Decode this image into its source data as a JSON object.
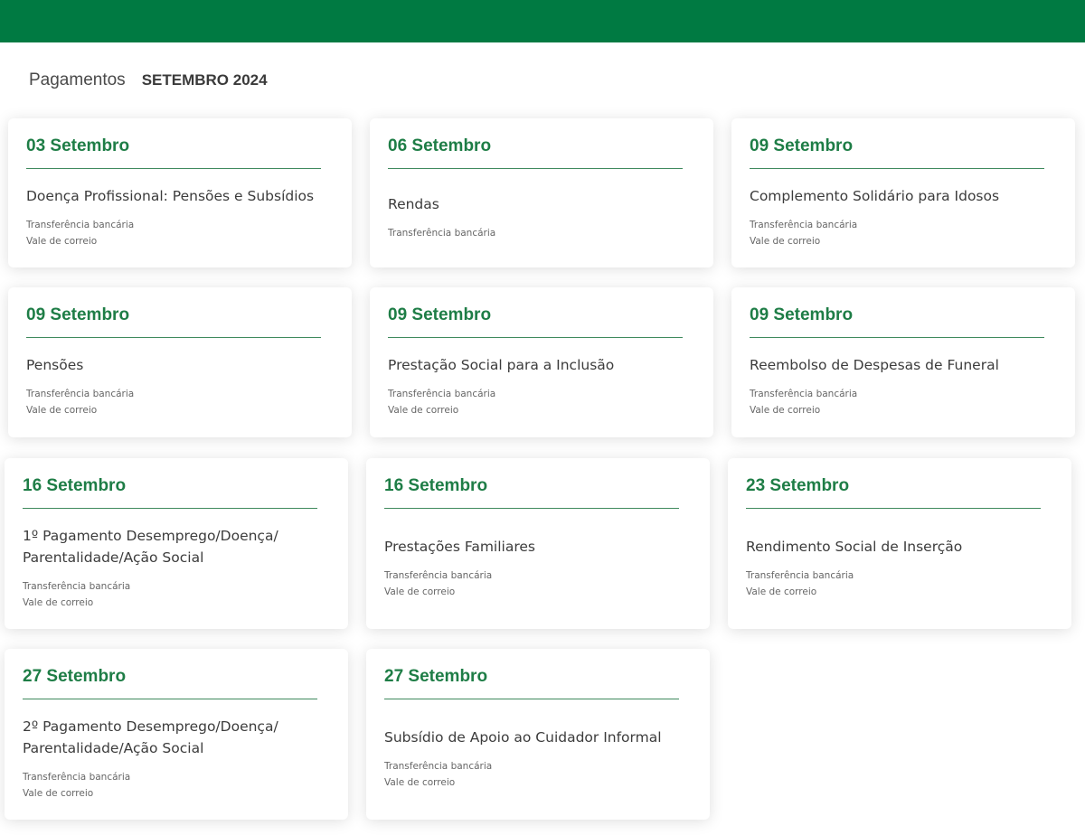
{
  "header": {
    "title": "Pagamentos",
    "month": "SETEMBRO 2024"
  },
  "accent_color": "#007a42",
  "cards": [
    {
      "date": "03 Setembro",
      "name": "Doença Profissional: Pensões e Subsídios",
      "methods": [
        "Transferência bancária",
        "Vale de correio"
      ]
    },
    {
      "date": "06 Setembro",
      "name": "Rendas",
      "methods": [
        "Transferência bancária"
      ]
    },
    {
      "date": "09 Setembro",
      "name": "Complemento Solidário para Idosos",
      "methods": [
        "Transferência bancária",
        "Vale de correio"
      ]
    },
    {
      "date": "09 Setembro",
      "name": "Pensões",
      "methods": [
        "Transferência bancária",
        "Vale de correio"
      ]
    },
    {
      "date": "09 Setembro",
      "name": "Prestação Social para a Inclusão",
      "methods": [
        "Transferência bancária",
        "Vale de correio"
      ]
    },
    {
      "date": "09 Setembro",
      "name": "Reembolso de Despesas de Funeral",
      "methods": [
        "Transferência bancária",
        "Vale de correio"
      ]
    },
    {
      "date": "16 Setembro",
      "name": "1º Pagamento Desemprego/Doença/ Parentalidade/Ação Social",
      "methods": [
        "Transferência bancária",
        "Vale de correio"
      ]
    },
    {
      "date": "16 Setembro",
      "name": "Prestações Familiares",
      "methods": [
        "Transferência bancária",
        "Vale de correio"
      ]
    },
    {
      "date": "23 Setembro",
      "name": "Rendimento Social de Inserção",
      "methods": [
        "Transferência bancária",
        "Vale de correio"
      ]
    },
    {
      "date": "27 Setembro",
      "name": "2º Pagamento Desemprego/Doença/ Parentalidade/Ação Social",
      "methods": [
        "Transferência bancária",
        "Vale de correio"
      ]
    },
    {
      "date": "27 Setembro",
      "name": "Subsídio de Apoio ao Cuidador Informal",
      "methods": [
        "Transferência bancária",
        "Vale de correio"
      ]
    }
  ]
}
